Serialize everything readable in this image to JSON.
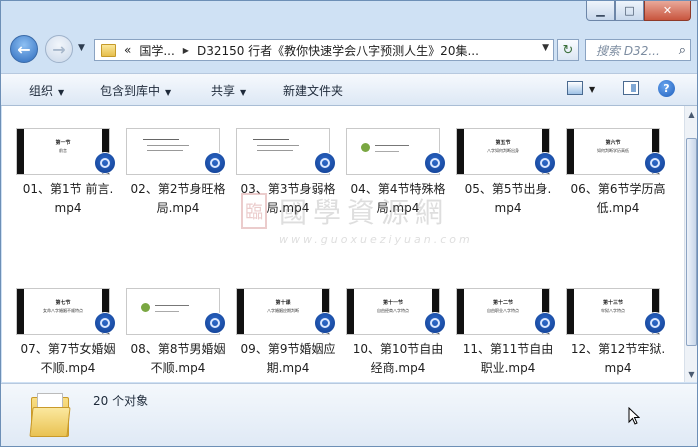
{
  "window": {
    "caption_buttons": [
      "minimize",
      "maximize",
      "close"
    ]
  },
  "navigation": {
    "address_prefix": "«",
    "path": [
      "国学...",
      "D32150 行者《教你快速学会八字预测人生》20集..."
    ],
    "search_placeholder": "搜索 D32...",
    "icons": {
      "back": "arrow-left-icon",
      "forward": "arrow-right-icon",
      "refresh": "refresh-icon",
      "search": "search-icon"
    }
  },
  "toolbar": {
    "organize": "组织",
    "include_in_library": "包含到库中",
    "share": "共享",
    "new_folder": "新建文件夹"
  },
  "files": [
    {
      "name": "01、第1节 前言.mp4",
      "line1": "01、第1节 前言.",
      "line2": "mp4",
      "thumb": {
        "title": "第一节",
        "subtitle": "前言",
        "style": "dark"
      }
    },
    {
      "name": "02、第2节身旺格局.mp4",
      "line1": "02、第2节身旺格",
      "line2": "局.mp4",
      "thumb": {
        "title": "",
        "subtitle": "",
        "style": "text"
      }
    },
    {
      "name": "03、第3节身弱格局.mp4",
      "line1": "03、第3节身弱格",
      "line2": "局.mp4",
      "thumb": {
        "title": "",
        "subtitle": "",
        "style": "text"
      }
    },
    {
      "name": "04、第4节特殊格局.mp4",
      "line1": "04、第4节特殊格",
      "line2": "局.mp4",
      "thumb": {
        "title": "",
        "subtitle": "",
        "style": "deco"
      }
    },
    {
      "name": "05、第5节出身.mp4",
      "line1": "05、第5节出身.",
      "line2": "mp4",
      "thumb": {
        "title": "第五节",
        "subtitle": "八字如何判断出身",
        "style": "dark"
      }
    },
    {
      "name": "06、第6节学历高低.mp4",
      "line1": "06、第6节学历高",
      "line2": "低.mp4",
      "thumb": {
        "title": "第六节",
        "subtitle": "如何判断学历高低",
        "style": "dark"
      }
    },
    {
      "name": "07、第7节女婚姻不顺.mp4",
      "line1": "07、第7节女婚姻",
      "line2": "不顺.mp4",
      "thumb": {
        "title": "第七节",
        "subtitle": "女命八字婚姻不顺特点",
        "style": "dark"
      }
    },
    {
      "name": "08、第8节男婚姻不顺.mp4",
      "line1": "08、第8节男婚姻",
      "line2": "不顺.mp4",
      "thumb": {
        "title": "",
        "subtitle": "",
        "style": "deco"
      }
    },
    {
      "name": "09、第9节婚姻应期.mp4",
      "line1": "09、第9节婚姻应",
      "line2": "期.mp4",
      "thumb": {
        "title": "第十课",
        "subtitle": "八字婚姻应期判断",
        "style": "dark"
      }
    },
    {
      "name": "10、第10节自由经商.mp4",
      "line1": "10、第10节自由",
      "line2": "经商.mp4",
      "thumb": {
        "title": "第十一节",
        "subtitle": "自由经商八字特点",
        "style": "dark"
      }
    },
    {
      "name": "11、第11节自由职业.mp4",
      "line1": "11、第11节自由",
      "line2": "职业.mp4",
      "thumb": {
        "title": "第十二节",
        "subtitle": "自由职业八字特点",
        "style": "dark"
      }
    },
    {
      "name": "12、第12节牢狱.mp4",
      "line1": "12、第12节牢狱.",
      "line2": "mp4",
      "thumb": {
        "title": "第十三节",
        "subtitle": "牢狱八字特点",
        "style": "dark"
      }
    }
  ],
  "watermark": {
    "text": "國學資源網",
    "url": "www.guoxueziyuan.com",
    "seal": "臨"
  },
  "status": {
    "count_text": "20 个对象"
  }
}
